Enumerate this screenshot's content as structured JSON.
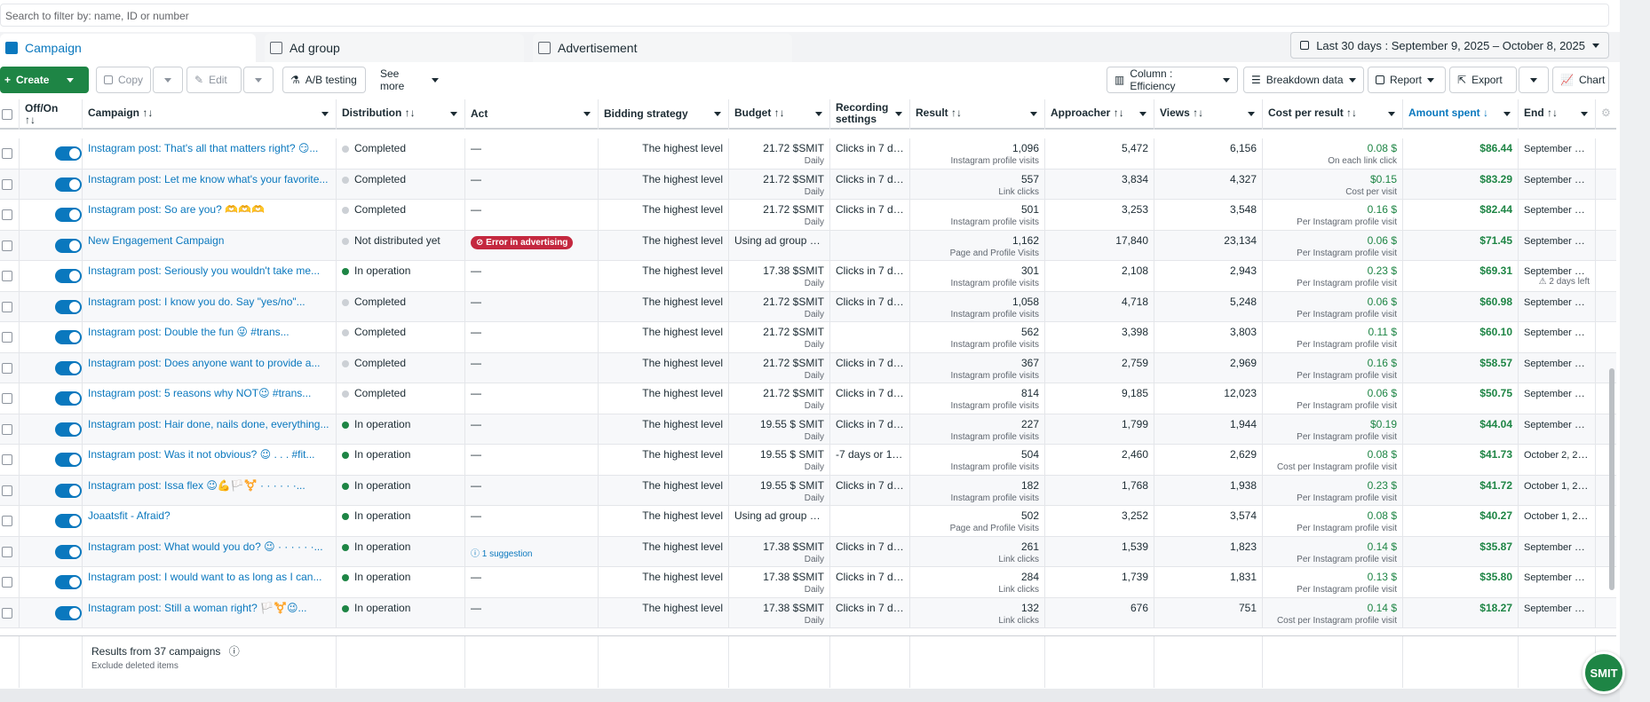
{
  "search": {
    "placeholder": "Search to filter by: name, ID or number"
  },
  "tabs": [
    {
      "label": "Campaign",
      "icon": "campaign-icon"
    },
    {
      "label": "Ad group",
      "icon": "ad-group-icon"
    },
    {
      "label": "Advertisement",
      "icon": "advertisement-icon"
    }
  ],
  "date_range": "Last 30 days : September 9, 2025 – October 8, 2025",
  "toolbar": {
    "create": "Create",
    "copy": "Copy",
    "edit": "Edit",
    "ab_testing": "A/B testing",
    "see_more": "See more",
    "column": "Column : Efficiency",
    "breakdown": "Breakdown data",
    "report": "Report",
    "export": "Export",
    "chart": "Chart"
  },
  "columns": {
    "offon": "Off/On",
    "campaign": "Campaign",
    "distribution": "Distribution",
    "act": "Act",
    "bidding": "Bidding strategy",
    "budget": "Budget",
    "recording": "Recording settings",
    "result": "Result",
    "approacher": "Approacher",
    "views": "Views",
    "cpr": "Cost per result",
    "spent": "Amount spent",
    "end": "End"
  },
  "rows": [
    {
      "name": "Instagram post: That's all that matters right? 😏...",
      "status": "Completed",
      "status_type": "done",
      "act": "—",
      "bidding": "The highest level",
      "budget": "21.72 $SMIT",
      "budget_sub": "Daily",
      "recording": "Clicks in 7 day...",
      "result": "1,096",
      "result_sub": "Instagram profile visits",
      "approacher": "5,472",
      "views": "6,156",
      "cpr": "0.08 $",
      "cpr_sub": "On each link click",
      "spent": "$86.44",
      "end": "September 12, ..."
    },
    {
      "name": "Instagram post: Let me know what's your favorite...",
      "status": "Completed",
      "status_type": "done",
      "act": "—",
      "bidding": "The highest level",
      "budget": "21.72 $SMIT",
      "budget_sub": "Daily",
      "recording": "Clicks in 7 day...",
      "result": "557",
      "result_sub": "Link clicks",
      "approacher": "3,834",
      "views": "4,327",
      "cpr": "$0.15",
      "cpr_sub": "Cost per visit",
      "spent": "$83.29",
      "end": "September 15, ..."
    },
    {
      "name": "Instagram post: So are you? 🫶🫶🫶",
      "status": "Completed",
      "status_type": "done",
      "act": "—",
      "bidding": "The highest level",
      "budget": "21.72 $SMIT",
      "budget_sub": "Daily",
      "recording": "Clicks in 7 day...",
      "result": "501",
      "result_sub": "Instagram profile visits",
      "approacher": "3,253",
      "views": "3,548",
      "cpr": "0.16 $",
      "cpr_sub": "Per Instagram profile visit",
      "spent": "$82.44",
      "end": "September 15, ..."
    },
    {
      "name": "New Engagement Campaign",
      "status": "Not distributed yet",
      "status_type": "done",
      "act": "Error in advertising",
      "act_type": "error",
      "bidding": "The highest level",
      "budget": "Using ad group bu...",
      "budget_sub": "",
      "recording": "",
      "result": "1,162",
      "result_sub": "Page and Profile Visits",
      "approacher": "17,840",
      "views": "23,134",
      "cpr": "0.06 $",
      "cpr_sub": "Per Instagram profile visit",
      "spent": "$71.45",
      "end": "September 17, ..."
    },
    {
      "name": "Instagram post: Seriously you wouldn't take me...",
      "status": "In operation",
      "status_type": "op",
      "act": "—",
      "bidding": "The highest level",
      "budget": "17.38 $SMIT",
      "budget_sub": "Daily",
      "recording": "Clicks in 7 day...",
      "result": "301",
      "result_sub": "Instagram profile visits",
      "approacher": "2,108",
      "views": "2,943",
      "cpr": "0.23 $",
      "cpr_sub": "Per Instagram profile visit",
      "spent": "$69.31",
      "end": "September 21, ...",
      "end_sub": "⚠ 2 days left"
    },
    {
      "name": "Instagram post: I know you do. Say \"yes/no\"...",
      "status": "Completed",
      "status_type": "done",
      "act": "—",
      "bidding": "The highest level",
      "budget": "21.72 $SMIT",
      "budget_sub": "Daily",
      "recording": "Clicks in 7 day...",
      "result": "1,058",
      "result_sub": "Instagram profile visits",
      "approacher": "4,718",
      "views": "5,248",
      "cpr": "0.06 $",
      "cpr_sub": "Per Instagram profile visit",
      "spent": "$60.98",
      "end": "September 21, ..."
    },
    {
      "name": "Instagram post: Double the fun 😜 #trans...",
      "status": "Completed",
      "status_type": "done",
      "act": "—",
      "bidding": "The highest level",
      "budget": "21.72 $SMIT",
      "budget_sub": "Daily",
      "recording": "",
      "result": "562",
      "result_sub": "Instagram profile visits",
      "approacher": "3,398",
      "views": "3,803",
      "cpr": "0.11 $",
      "cpr_sub": "Per Instagram profile visit",
      "spent": "$60.10",
      "end": "September 21, ..."
    },
    {
      "name": "Instagram post: Does anyone want to provide a...",
      "status": "Completed",
      "status_type": "done",
      "act": "—",
      "bidding": "The highest level",
      "budget": "21.72 $SMIT",
      "budget_sub": "Daily",
      "recording": "Clicks in 7 day...",
      "result": "367",
      "result_sub": "Instagram profile visits",
      "approacher": "2,759",
      "views": "2,969",
      "cpr": "0.16 $",
      "cpr_sub": "Per Instagram profile visit",
      "spent": "$58.57",
      "end": "September 21, ..."
    },
    {
      "name": "Instagram post: 5 reasons why NOT😉 #trans...",
      "status": "Completed",
      "status_type": "done",
      "act": "—",
      "bidding": "The highest level",
      "budget": "21.72 $SMIT",
      "budget_sub": "Daily",
      "recording": "Clicks in 7 day...",
      "result": "814",
      "result_sub": "Instagram profile visits",
      "approacher": "9,185",
      "views": "12,023",
      "cpr": "0.06 $",
      "cpr_sub": "Per Instagram profile visit",
      "spent": "$50.75",
      "end": "September 21, ..."
    },
    {
      "name": "Instagram post: Hair done, nails done, everything...",
      "status": "In operation",
      "status_type": "op",
      "act": "—",
      "bidding": "The highest level",
      "budget": "19.55 $ SMIT",
      "budget_sub": "Daily",
      "recording": "Clicks in 7 day...",
      "result": "227",
      "result_sub": "Instagram profile visits",
      "approacher": "1,799",
      "views": "1,944",
      "cpr": "$0.19",
      "cpr_sub": "Per Instagram profile visit",
      "spent": "$44.04",
      "end": "September 21, ..."
    },
    {
      "name": "Instagram post: Was it not obvious? 😉 . . . #fit...",
      "status": "In operation",
      "status_type": "op",
      "act": "—",
      "bidding": "The highest level",
      "budget": "19.55 $ SMIT",
      "budget_sub": "Daily",
      "recording": "-7 days or 1 d...",
      "result": "504",
      "result_sub": "Instagram profile visits",
      "approacher": "2,460",
      "views": "2,629",
      "cpr": "0.08 $",
      "cpr_sub": "Cost per Instagram profile visit",
      "spent": "$41.73",
      "end": "October 2, 2025"
    },
    {
      "name": "Instagram post: Issa flex 😉💪🏳️⚧️ · · · · · ·...",
      "status": "In operation",
      "status_type": "op",
      "act": "—",
      "bidding": "The highest level",
      "budget": "19.55 $ SMIT",
      "budget_sub": "Daily",
      "recording": "Clicks in 7 day...",
      "result": "182",
      "result_sub": "Instagram profile visits",
      "approacher": "1,768",
      "views": "1,938",
      "cpr": "0.23 $",
      "cpr_sub": "Per Instagram profile visit",
      "spent": "$41.72",
      "end": "October 1, 2025"
    },
    {
      "name": "Joaatsfit - Afraid?",
      "status": "In operation",
      "status_type": "op",
      "act": "—",
      "bidding": "The highest level",
      "budget": "Using ad group bu...",
      "budget_sub": "",
      "recording": "",
      "result": "502",
      "result_sub": "Page and Profile Visits",
      "approacher": "3,252",
      "views": "3,574",
      "cpr": "0.08 $",
      "cpr_sub": "Per Instagram profile visit",
      "spent": "$40.27",
      "end": "October 1, 2025"
    },
    {
      "name": "Instagram post: What would you do? 😉 · · · · · ·...",
      "status": "In operation",
      "status_type": "op",
      "act": "1 suggestion",
      "act_type": "suggest",
      "bidding": "The highest level",
      "budget": "17.38 $SMIT",
      "budget_sub": "Daily",
      "recording": "Clicks in 7 day...",
      "result": "261",
      "result_sub": "Link clicks",
      "approacher": "1,539",
      "views": "1,823",
      "cpr": "0.14 $",
      "cpr_sub": "Per Instagram profile visit",
      "spent": "$35.87",
      "end": "September 13, ..."
    },
    {
      "name": "Instagram post: I would want to as long as I can...",
      "status": "In operation",
      "status_type": "op",
      "act": "—",
      "bidding": "The highest level",
      "budget": "17.38 $SMIT",
      "budget_sub": "Daily",
      "recording": "Clicks in 7 day...",
      "result": "284",
      "result_sub": "Link clicks",
      "approacher": "1,739",
      "views": "1,831",
      "cpr": "0.13 $",
      "cpr_sub": "Per Instagram profile visit",
      "spent": "$35.80",
      "end": "September 11, ..."
    },
    {
      "name": "Instagram post: Still a woman right? 🏳️⚧️😉...",
      "status": "In operation",
      "status_type": "op",
      "act": "—",
      "bidding": "The highest level",
      "budget": "17.38 $SMIT",
      "budget_sub": "Daily",
      "recording": "Clicks in 7 day...",
      "result": "132",
      "result_sub": "Link clicks",
      "approacher": "676",
      "views": "751",
      "cpr": "0.14 $",
      "cpr_sub": "Cost per Instagram profile visit",
      "spent": "$18.27",
      "end": "September 11, ..."
    }
  ],
  "footer": {
    "results": "Results from 37 campaigns",
    "exclude": "Exclude deleted items"
  },
  "fab": "SMIT",
  "colors": {
    "accent": "#0a78be",
    "green": "#1e8545",
    "error": "#c4283f"
  }
}
